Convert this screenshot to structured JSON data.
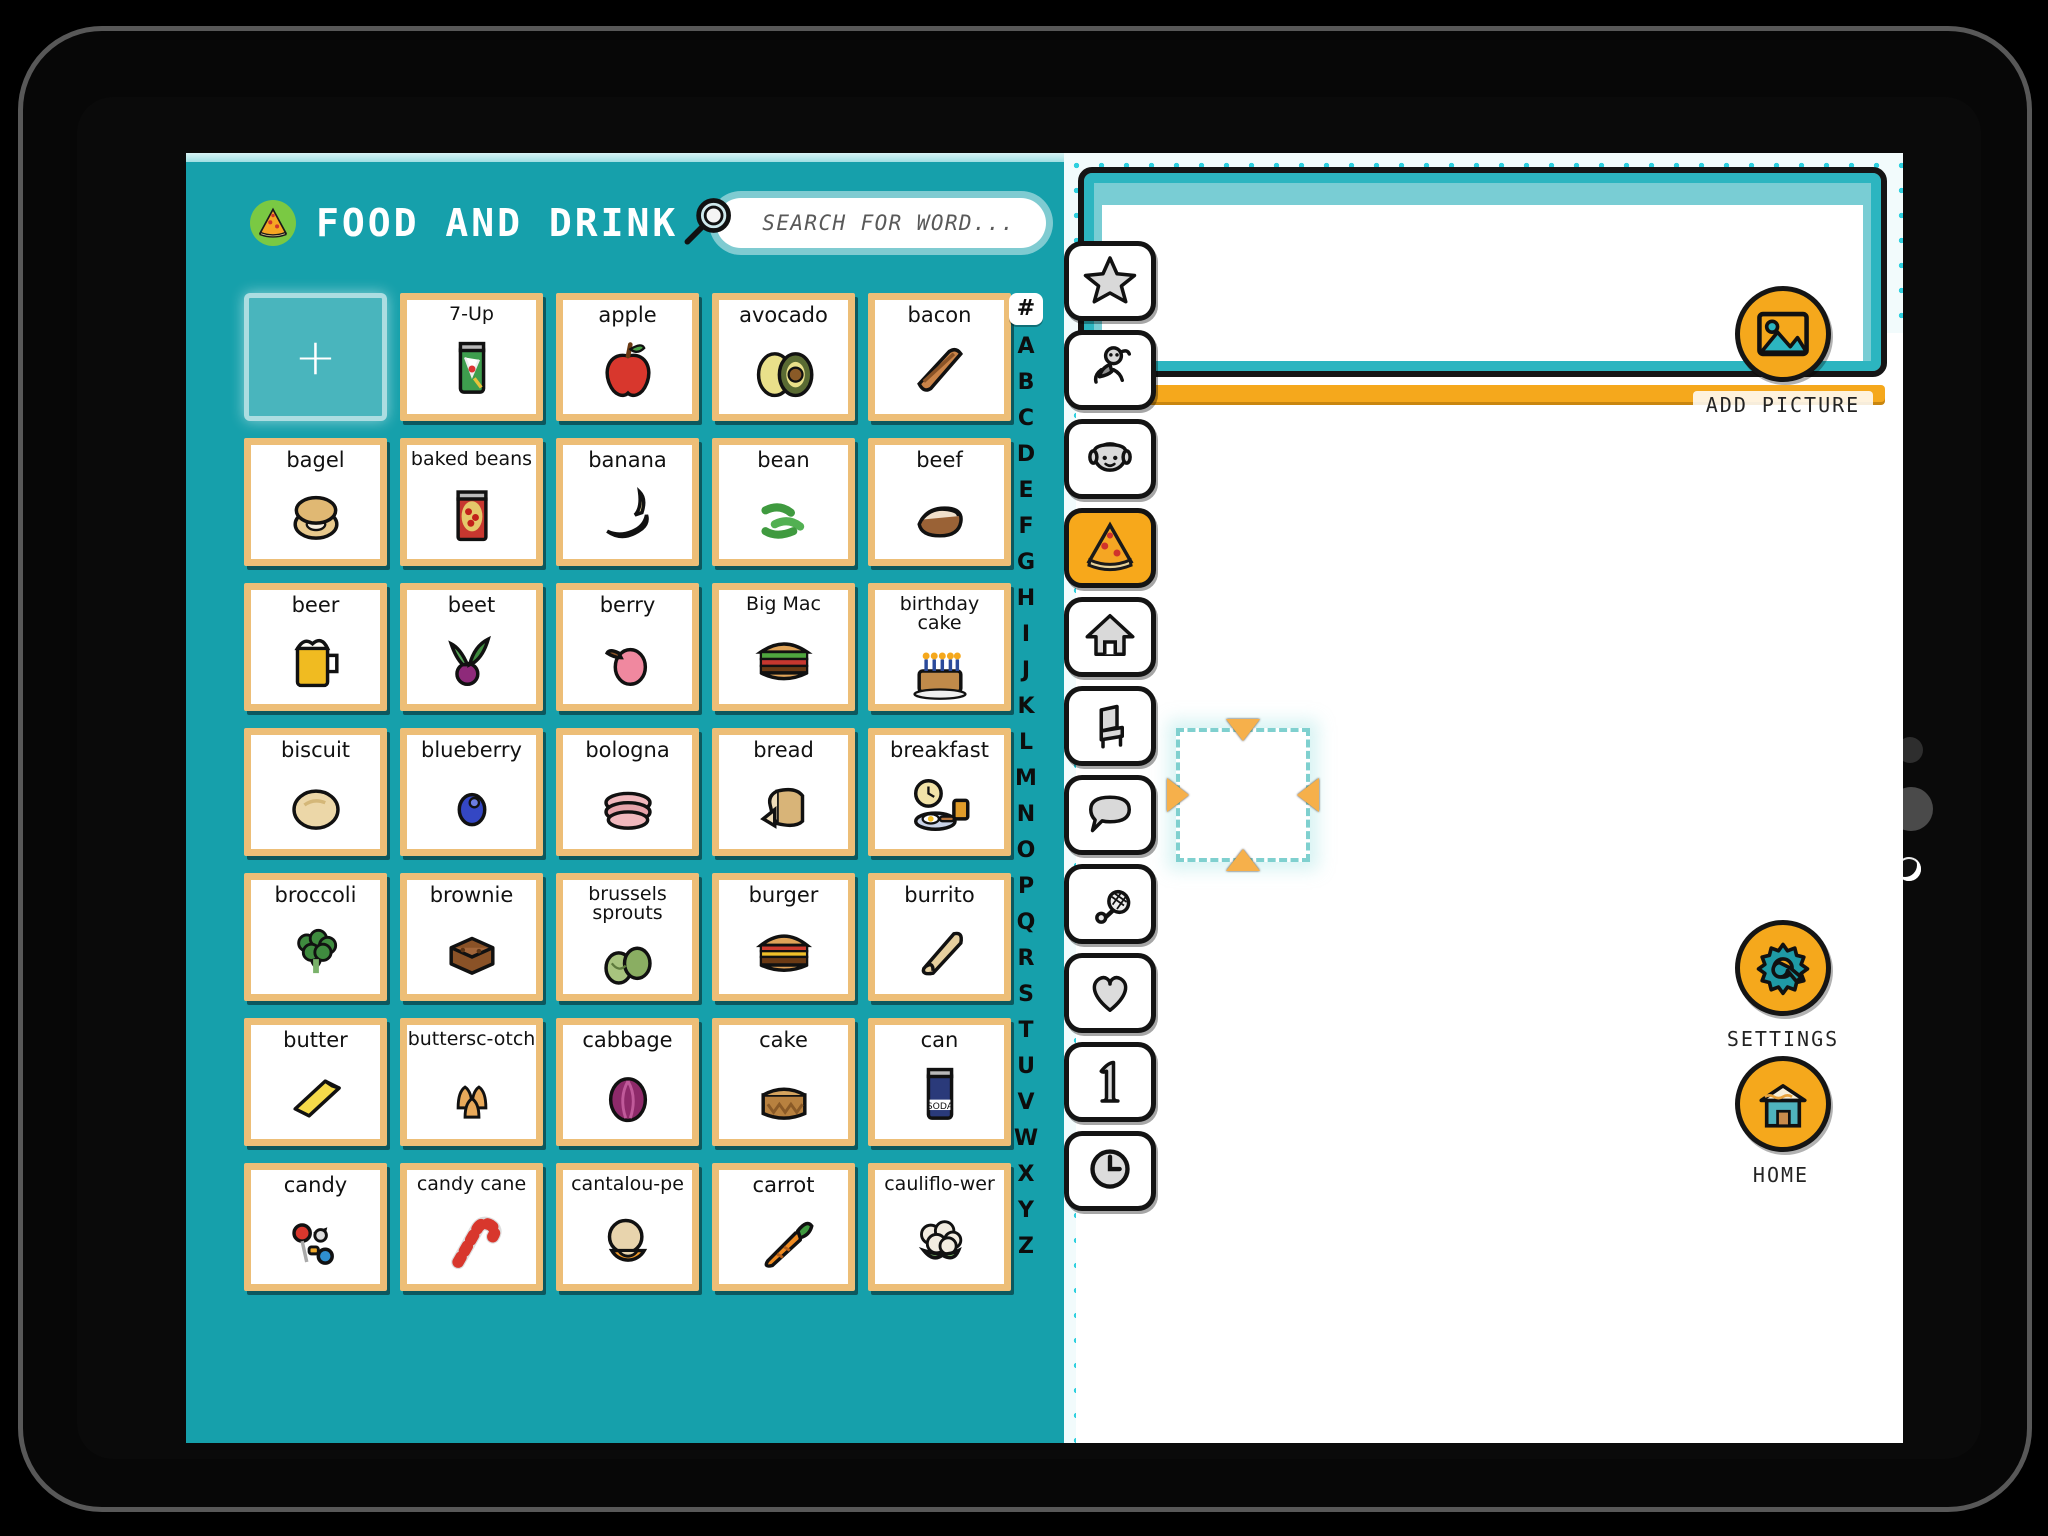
{
  "app": {
    "board_title": "FOOD AND DRINK",
    "board_icon": "pizza-icon"
  },
  "search": {
    "placeholder": "SEARCH FOR WORD...",
    "value": "",
    "icon": "magnifier-icon"
  },
  "add_tile": {
    "label": "+"
  },
  "alphabet_index": {
    "active": "#",
    "letters": [
      "#",
      "A",
      "B",
      "C",
      "D",
      "E",
      "F",
      "G",
      "H",
      "I",
      "J",
      "K",
      "L",
      "M",
      "N",
      "O",
      "P",
      "Q",
      "R",
      "S",
      "T",
      "U",
      "V",
      "W",
      "X",
      "Y",
      "Z"
    ]
  },
  "category_rail": [
    {
      "name": "favourites",
      "icon": "star-icon",
      "active": false
    },
    {
      "name": "actions",
      "icon": "person-running-icon",
      "active": false
    },
    {
      "name": "people",
      "icon": "face-icon",
      "active": false
    },
    {
      "name": "food-and-drink",
      "icon": "pizza-icon",
      "active": true
    },
    {
      "name": "places",
      "icon": "house-icon",
      "active": false
    },
    {
      "name": "objects",
      "icon": "chair-icon",
      "active": false
    },
    {
      "name": "phrases",
      "icon": "speech-bubble-icon",
      "active": false
    },
    {
      "name": "sports",
      "icon": "racket-icon",
      "active": false
    },
    {
      "name": "feelings",
      "icon": "heart-icon",
      "active": false
    },
    {
      "name": "numbers",
      "icon": "number-one-icon",
      "active": false
    },
    {
      "name": "time",
      "icon": "clock-icon",
      "active": false
    }
  ],
  "words": [
    {
      "label": "7-Up",
      "icon": "soda-can-icon"
    },
    {
      "label": "apple",
      "icon": "apple-icon"
    },
    {
      "label": "avocado",
      "icon": "avocado-icon"
    },
    {
      "label": "bacon",
      "icon": "bacon-icon"
    },
    {
      "label": "bagel",
      "icon": "bagel-icon"
    },
    {
      "label": "baked beans",
      "icon": "baked-beans-icon"
    },
    {
      "label": "banana",
      "icon": "banana-icon"
    },
    {
      "label": "bean",
      "icon": "green-beans-icon"
    },
    {
      "label": "beef",
      "icon": "beef-icon"
    },
    {
      "label": "beer",
      "icon": "beer-mug-icon"
    },
    {
      "label": "beet",
      "icon": "beet-icon"
    },
    {
      "label": "berry",
      "icon": "berry-icon"
    },
    {
      "label": "Big Mac",
      "icon": "big-mac-icon"
    },
    {
      "label": "birthday cake",
      "icon": "birthday-cake-icon"
    },
    {
      "label": "biscuit",
      "icon": "biscuit-icon"
    },
    {
      "label": "blueberry",
      "icon": "blueberry-icon"
    },
    {
      "label": "bologna",
      "icon": "bologna-icon"
    },
    {
      "label": "bread",
      "icon": "bread-icon"
    },
    {
      "label": "breakfast",
      "icon": "breakfast-plate-icon"
    },
    {
      "label": "broccoli",
      "icon": "broccoli-icon"
    },
    {
      "label": "brownie",
      "icon": "brownie-icon"
    },
    {
      "label": "brussels sprouts",
      "icon": "brussels-sprouts-icon"
    },
    {
      "label": "burger",
      "icon": "burger-icon"
    },
    {
      "label": "burrito",
      "icon": "burrito-icon"
    },
    {
      "label": "butter",
      "icon": "butter-stick-icon"
    },
    {
      "label": "buttersc-otch",
      "icon": "butterscotch-icon"
    },
    {
      "label": "cabbage",
      "icon": "cabbage-icon"
    },
    {
      "label": "cake",
      "icon": "cake-icon"
    },
    {
      "label": "can",
      "icon": "soda-can-blue-icon"
    },
    {
      "label": "candy",
      "icon": "candy-icon"
    },
    {
      "label": "candy cane",
      "icon": "candy-cane-icon"
    },
    {
      "label": "cantalou-pe",
      "icon": "cantaloupe-icon"
    },
    {
      "label": "carrot",
      "icon": "carrot-icon"
    },
    {
      "label": "cauliflo-wer",
      "icon": "cauliflower-icon"
    }
  ],
  "canvas": {
    "sentence_bar_value": "",
    "selection_placeholder": "empty-image-slot"
  },
  "actions": {
    "add_picture": {
      "label": "ADD PICTURE",
      "icon": "image-icon"
    },
    "settings": {
      "label": "SETTINGS",
      "icon": "gear-wrench-icon"
    },
    "home": {
      "label": "HOME",
      "icon": "house-shop-icon"
    }
  },
  "colors": {
    "panel_teal": "#16a0ab",
    "accent_orange": "#f5a81c",
    "card_border_tan": "#edbe77",
    "dot_cyan": "#2fd0df"
  }
}
